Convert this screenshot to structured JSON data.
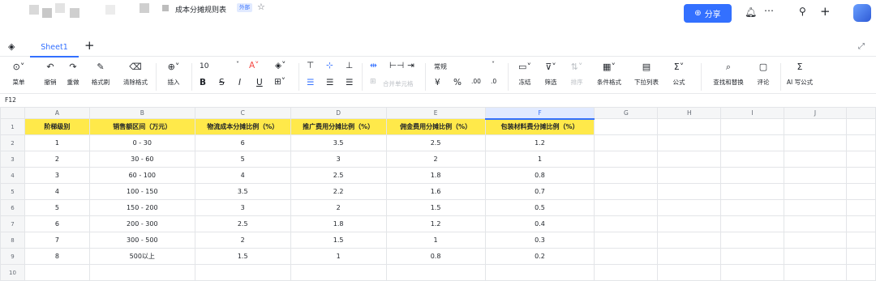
{
  "header": {
    "doc_title": "成本分摊规则表",
    "ext_tag": "外部",
    "share_label": "分享"
  },
  "tab_name": "Sheet1",
  "toolbar": {
    "menu": "菜单",
    "undo": "撤销",
    "redo": "重做",
    "format_painter": "格式刷",
    "clear_format": "清除格式",
    "insert": "插入",
    "font_size": "10",
    "number_format": "常规",
    "merge": "合并单元格",
    "freeze": "冻结",
    "filter": "筛选",
    "sort": "排序",
    "cond_format": "条件格式",
    "dropdown": "下拉列表",
    "formula": "公式",
    "find_replace": "查找和替换",
    "comment": "评论",
    "ai_formula": "AI 写公式",
    "yen": "¥",
    "percent": "%",
    "dec_dec": ".00",
    "dec_inc": ".0"
  },
  "cell_ref": "F12",
  "sheet": {
    "col_letters": [
      "A",
      "B",
      "C",
      "D",
      "E",
      "F",
      "G",
      "H",
      "I",
      "J"
    ],
    "row_numbers": [
      "1",
      "2",
      "3",
      "4",
      "5",
      "6",
      "7",
      "8",
      "9",
      "10"
    ],
    "headers": [
      "阶梯级别",
      "销售额区间（万元）",
      "物流成本分摊比例（%）",
      "推广费用分摊比例（%）",
      "佣金费用分摊比例（%）",
      "包装材料费分摊比例（%）"
    ],
    "rows": [
      [
        "1",
        "0 - 30",
        "6",
        "3.5",
        "2.5",
        "1.2"
      ],
      [
        "2",
        "30 - 60",
        "5",
        "3",
        "2",
        "1"
      ],
      [
        "3",
        "60 - 100",
        "4",
        "2.5",
        "1.8",
        "0.8"
      ],
      [
        "4",
        "100 - 150",
        "3.5",
        "2.2",
        "1.6",
        "0.7"
      ],
      [
        "5",
        "150 - 200",
        "3",
        "2",
        "1.5",
        "0.5"
      ],
      [
        "6",
        "200 - 300",
        "2.5",
        "1.8",
        "1.2",
        "0.4"
      ],
      [
        "7",
        "300 - 500",
        "2",
        "1.5",
        "1",
        "0.3"
      ],
      [
        "8",
        "500以上",
        "1.5",
        "1",
        "0.8",
        "0.2"
      ]
    ]
  },
  "colors": {
    "accent": "#3370ff",
    "header_fill": "#ffe94a"
  }
}
